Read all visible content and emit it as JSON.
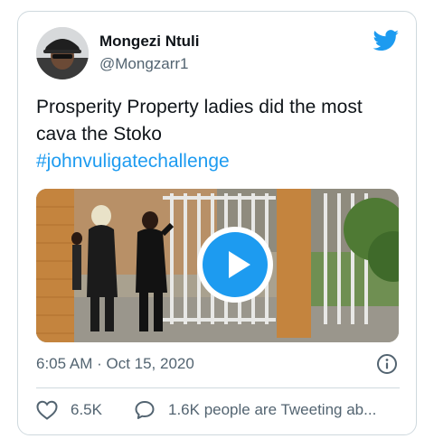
{
  "tweet": {
    "author": {
      "display_name": "Mongezi Ntuli",
      "handle": "@Mongzarr1",
      "avatar": "profile-photo"
    },
    "brand_icon": "twitter-bird-icon",
    "text": "Prosperity Property ladies did the most cava the Stoko",
    "hashtag": "#johnvuligatechallenge",
    "media": {
      "type": "video",
      "control_icon": "play-icon"
    },
    "timestamp": "6:05 AM · Oct 15, 2020",
    "info_icon": "info-icon",
    "actions": {
      "like_icon": "heart-icon",
      "like_count": "6.5K",
      "reply_icon": "speech-bubble-icon",
      "conversation_text": "1.6K people are Tweeting ab..."
    },
    "colors": {
      "accent": "#1d9bf0",
      "text_primary": "#0f1419",
      "text_secondary": "#536471",
      "border": "#cfd9de"
    }
  }
}
